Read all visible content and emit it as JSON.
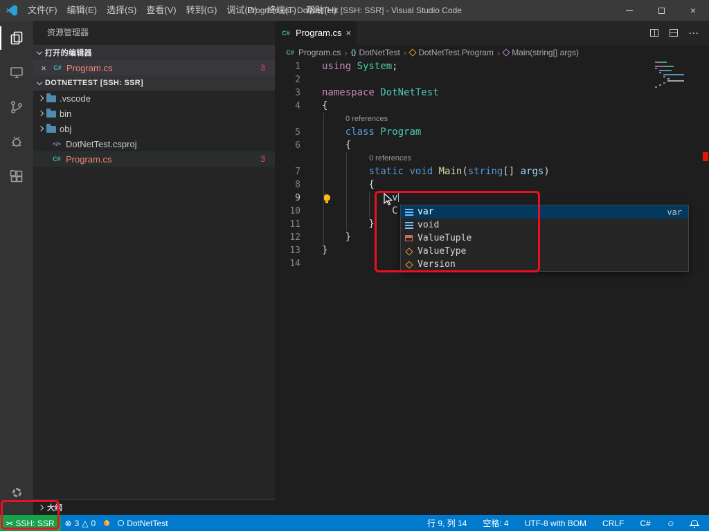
{
  "icons": {
    "close": "×",
    "csharp": "C#",
    "namespace_braces": "{}",
    "csproj": "</>",
    "remote": "><",
    "error": "⊗",
    "warning": "△",
    "smiley": "☺",
    "ellipsis": "···",
    "crumb_sep": "›"
  },
  "colors": {
    "status_bar_blue": "#007acc",
    "remote_green": "#14a348",
    "badge_red": "#f14c4c",
    "error_file_red": "#f48771",
    "annotation_red": "#e81123",
    "suggest_selection_blue": "#04395e"
  },
  "title_bar": {
    "menus": [
      "文件(F)",
      "编辑(E)",
      "选择(S)",
      "查看(V)",
      "转到(G)",
      "调试(D)",
      "终端(T)",
      "帮助(H)"
    ],
    "title": "Program.cs - DotNetTest [SSH: SSR] - Visual Studio Code"
  },
  "sidebar": {
    "title": "资源管理器",
    "open_editors_header": "打开的编辑器",
    "open_editor": {
      "name": "Program.cs",
      "badge": "3"
    },
    "section_header": "DOTNETTEST [SSH: SSR]",
    "tree": [
      {
        "label": ".vscode"
      },
      {
        "label": "bin"
      },
      {
        "label": "obj"
      },
      {
        "label": "DotNetTest.csproj"
      },
      {
        "label": "Program.cs",
        "badge": "3"
      }
    ],
    "outline_header": "大纲"
  },
  "editor": {
    "tab": "Program.cs",
    "breadcrumbs": [
      "Program.cs",
      "DotNetTest",
      "DotNetTest.Program",
      "Main(string[] args)"
    ],
    "codelens": "0 references"
  },
  "code": {
    "nums": [
      "1",
      "2",
      "3",
      "4",
      "5",
      "6",
      "7",
      "8",
      "9",
      "10",
      "11",
      "12",
      "13",
      "14"
    ],
    "l1": [
      "using ",
      "System",
      ";"
    ],
    "l3": [
      "namespace ",
      "DotNetTest"
    ],
    "l4": "{",
    "l5": [
      "    ",
      "class ",
      "Program"
    ],
    "l6": "    {",
    "l7": [
      "        ",
      "static void ",
      "Main",
      "(",
      "string",
      "[] ",
      "args",
      ")"
    ],
    "l8": "        {",
    "l9": [
      "            ",
      "v"
    ],
    "l10": [
      "            ",
      "C"
    ],
    "l11": "        }",
    "l12": "    }",
    "l13": "}"
  },
  "suggest": {
    "items": [
      {
        "label": "var",
        "detail": "var"
      },
      {
        "label": "void"
      },
      {
        "label": "ValueTuple"
      },
      {
        "label": "ValueType"
      },
      {
        "label": "Version"
      }
    ]
  },
  "status_bar": {
    "remote": "SSH: SSR",
    "errors": "3",
    "warnings": "0",
    "project": "DotNetTest",
    "cursor": "行 9, 列 14",
    "indent": "空格: 4",
    "encoding": "UTF-8 with BOM",
    "eol": "CRLF",
    "lang": "C#"
  }
}
